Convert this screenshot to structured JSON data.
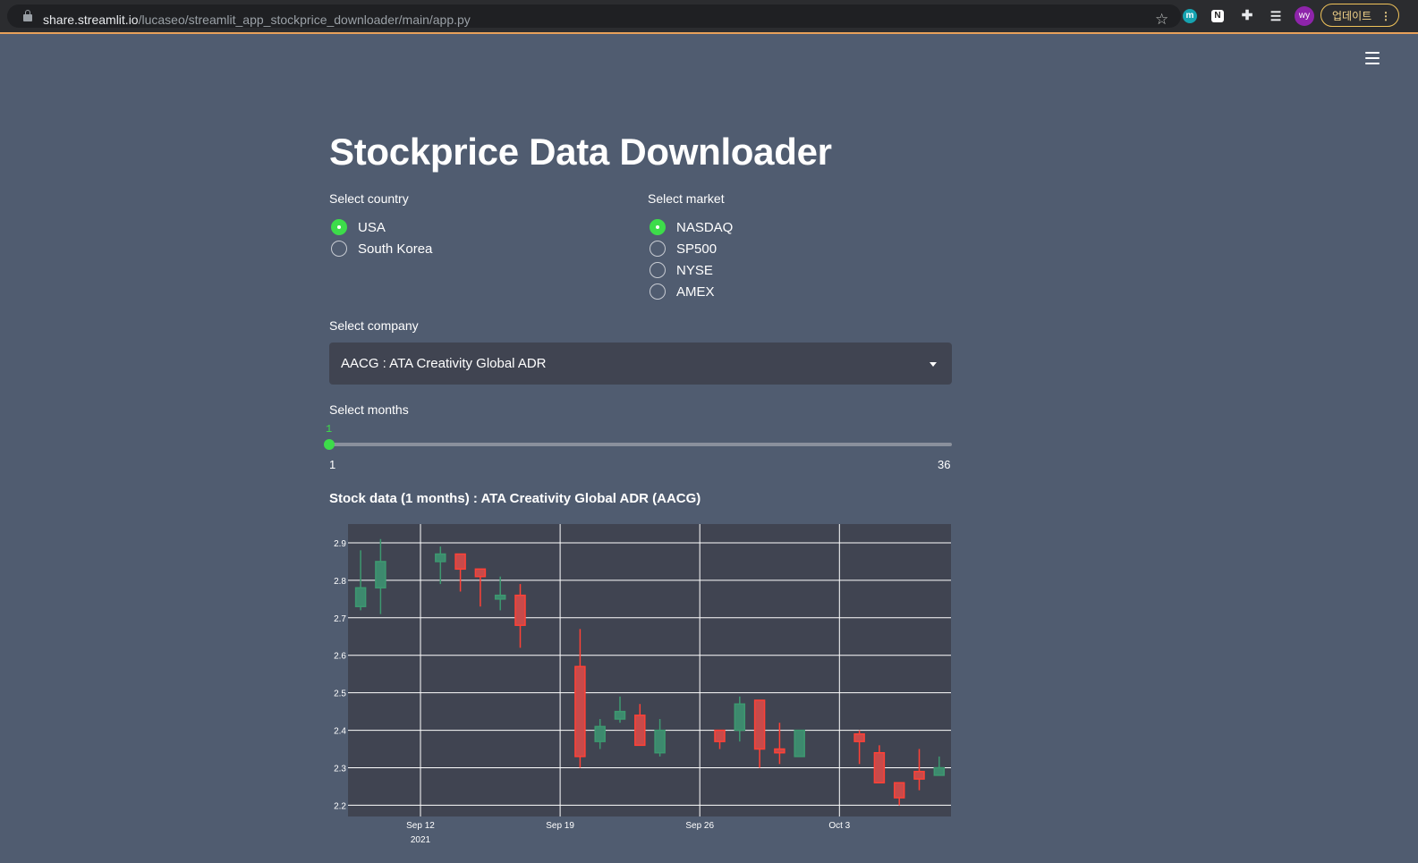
{
  "browser": {
    "url_host": "share.streamlit.io",
    "url_path": "/lucaseo/streamlit_app_stockprice_downloader/main/app.py",
    "avatar_initials": "wy",
    "update_label": "업데이트",
    "ext_m_label": "m",
    "ext_n_label": "N"
  },
  "page": {
    "title": "Stockprice Data Downloader"
  },
  "country": {
    "label": "Select country",
    "options": [
      "USA",
      "South Korea"
    ],
    "selected": "USA"
  },
  "market": {
    "label": "Select market",
    "options": [
      "NASDAQ",
      "SP500",
      "NYSE",
      "AMEX"
    ],
    "selected": "NASDAQ"
  },
  "company": {
    "label": "Select company",
    "value": "AACG : ATA Creativity Global ADR"
  },
  "months": {
    "label": "Select months",
    "value": "1",
    "min": "1",
    "max": "36"
  },
  "chart_title": "Stock data (1 months) : ATA Creativity Global ADR (AACG)",
  "chart_data": {
    "type": "candlestick",
    "ylim": [
      2.17,
      2.95
    ],
    "yticks": [
      2.2,
      2.3,
      2.4,
      2.5,
      2.6,
      2.7,
      2.8,
      2.9
    ],
    "xtick_labels": [
      "Sep 12",
      "Sep 19",
      "Sep 26",
      "Oct 3"
    ],
    "xtick_sublabel": "2021",
    "colors": {
      "up": "#3d9970",
      "down": "#ff4136",
      "bg": "#404451",
      "grid": "#ffffff"
    },
    "candles": [
      {
        "date": "2021-09-09",
        "open": 2.73,
        "high": 2.88,
        "low": 2.72,
        "close": 2.78
      },
      {
        "date": "2021-09-10",
        "open": 2.78,
        "high": 2.91,
        "low": 2.71,
        "close": 2.85
      },
      {
        "date": "2021-09-13",
        "open": 2.85,
        "high": 2.89,
        "low": 2.79,
        "close": 2.87
      },
      {
        "date": "2021-09-14",
        "open": 2.87,
        "high": 2.87,
        "low": 2.77,
        "close": 2.83
      },
      {
        "date": "2021-09-15",
        "open": 2.83,
        "high": 2.83,
        "low": 2.73,
        "close": 2.81
      },
      {
        "date": "2021-09-16",
        "open": 2.75,
        "high": 2.81,
        "low": 2.72,
        "close": 2.76
      },
      {
        "date": "2021-09-17",
        "open": 2.76,
        "high": 2.79,
        "low": 2.62,
        "close": 2.68
      },
      {
        "date": "2021-09-20",
        "open": 2.57,
        "high": 2.67,
        "low": 2.3,
        "close": 2.33
      },
      {
        "date": "2021-09-21",
        "open": 2.37,
        "high": 2.43,
        "low": 2.35,
        "close": 2.41
      },
      {
        "date": "2021-09-22",
        "open": 2.43,
        "high": 2.49,
        "low": 2.42,
        "close": 2.45
      },
      {
        "date": "2021-09-23",
        "open": 2.44,
        "high": 2.47,
        "low": 2.36,
        "close": 2.36
      },
      {
        "date": "2021-09-24",
        "open": 2.34,
        "high": 2.43,
        "low": 2.33,
        "close": 2.4
      },
      {
        "date": "2021-09-27",
        "open": 2.4,
        "high": 2.4,
        "low": 2.35,
        "close": 2.37
      },
      {
        "date": "2021-09-28",
        "open": 2.4,
        "high": 2.49,
        "low": 2.37,
        "close": 2.47
      },
      {
        "date": "2021-09-29",
        "open": 2.48,
        "high": 2.48,
        "low": 2.3,
        "close": 2.35
      },
      {
        "date": "2021-09-30",
        "open": 2.35,
        "high": 2.42,
        "low": 2.31,
        "close": 2.34
      },
      {
        "date": "2021-10-01",
        "open": 2.33,
        "high": 2.4,
        "low": 2.33,
        "close": 2.4
      },
      {
        "date": "2021-10-04",
        "open": 2.39,
        "high": 2.4,
        "low": 2.31,
        "close": 2.37
      },
      {
        "date": "2021-10-05",
        "open": 2.34,
        "high": 2.36,
        "low": 2.26,
        "close": 2.26
      },
      {
        "date": "2021-10-06",
        "open": 2.26,
        "high": 2.26,
        "low": 2.2,
        "close": 2.22
      },
      {
        "date": "2021-10-07",
        "open": 2.29,
        "high": 2.35,
        "low": 2.24,
        "close": 2.27
      },
      {
        "date": "2021-10-08",
        "open": 2.28,
        "high": 2.33,
        "low": 2.28,
        "close": 2.3
      }
    ]
  }
}
